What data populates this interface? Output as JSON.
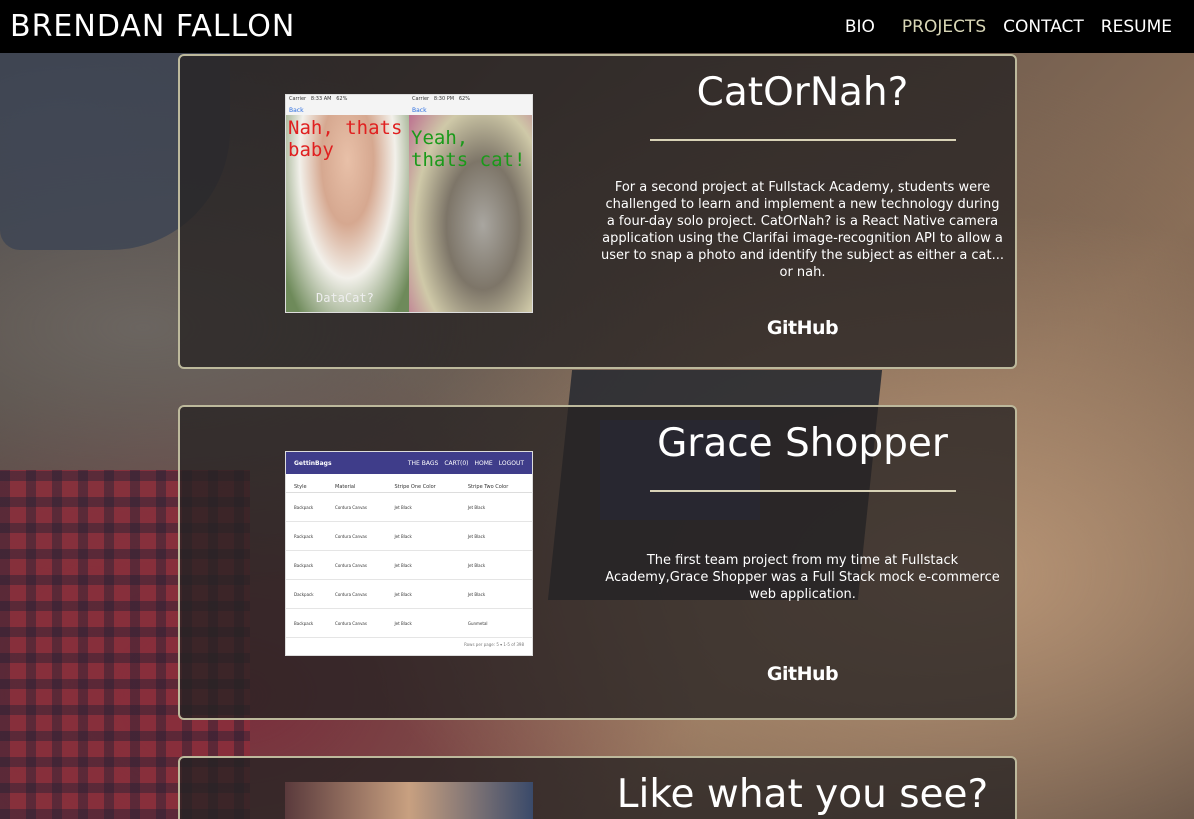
{
  "header": {
    "brand": "BRENDAN FALLON",
    "nav": [
      {
        "label": "BIO",
        "active": false
      },
      {
        "label": "PROJECTS",
        "active": true
      },
      {
        "label": "CONTACT",
        "active": false
      },
      {
        "label": "RESUME",
        "active": false
      }
    ]
  },
  "projects": [
    {
      "title": "CatOrNah?",
      "description": "For a second project at Fullstack Academy, students were challenged to learn and implement a new technology during a four-day solo project. CatOrNah? is a React Native camera application using the Clarifai image-recognition API to allow a user to snap a photo and identify the subject as either a cat... or nah.",
      "link_label": "GitHub",
      "screenshot": {
        "status_left": "Carrier",
        "time_left": "8:33 AM",
        "time_right": "8:30 PM",
        "battery": "62%",
        "back_label": "Back",
        "left_caption": "Nah, thats baby",
        "right_caption": "Yeah, thats cat!",
        "bottom_caption": "DataCat?"
      }
    },
    {
      "title": "Grace Shopper",
      "description": "The first team project from my time at Fullstack Academy,Grace Shopper was a Full Stack mock e-commerce web application.",
      "link_label": "GitHub",
      "screenshot": {
        "brand": "GettinBags",
        "links": [
          "THE BAGS",
          "CART(0)",
          "HOME",
          "LOGOUT"
        ],
        "columns": [
          "Style",
          "Material",
          "Stripe One Color",
          "Stripe Two Color"
        ],
        "rows": [
          [
            "Backpack",
            "Cordura Canvas",
            "Jet Black",
            "Jet Black"
          ],
          [
            "Rackpack",
            "Cordura Canvas",
            "Jet Black",
            "Jet Black"
          ],
          [
            "Backpack",
            "Cordura Canvas",
            "Jet Black",
            "Jet Black"
          ],
          [
            "Dackpack",
            "Cordura Canvas",
            "Jet Black",
            "Jet Black"
          ],
          [
            "Backpack",
            "Cordura Canvas",
            "Jet Black",
            "Gunmetal"
          ]
        ],
        "footer": "Rows per page:  5  ▾      1-5 of 398"
      }
    },
    {
      "title": "Like what you see?"
    }
  ]
}
